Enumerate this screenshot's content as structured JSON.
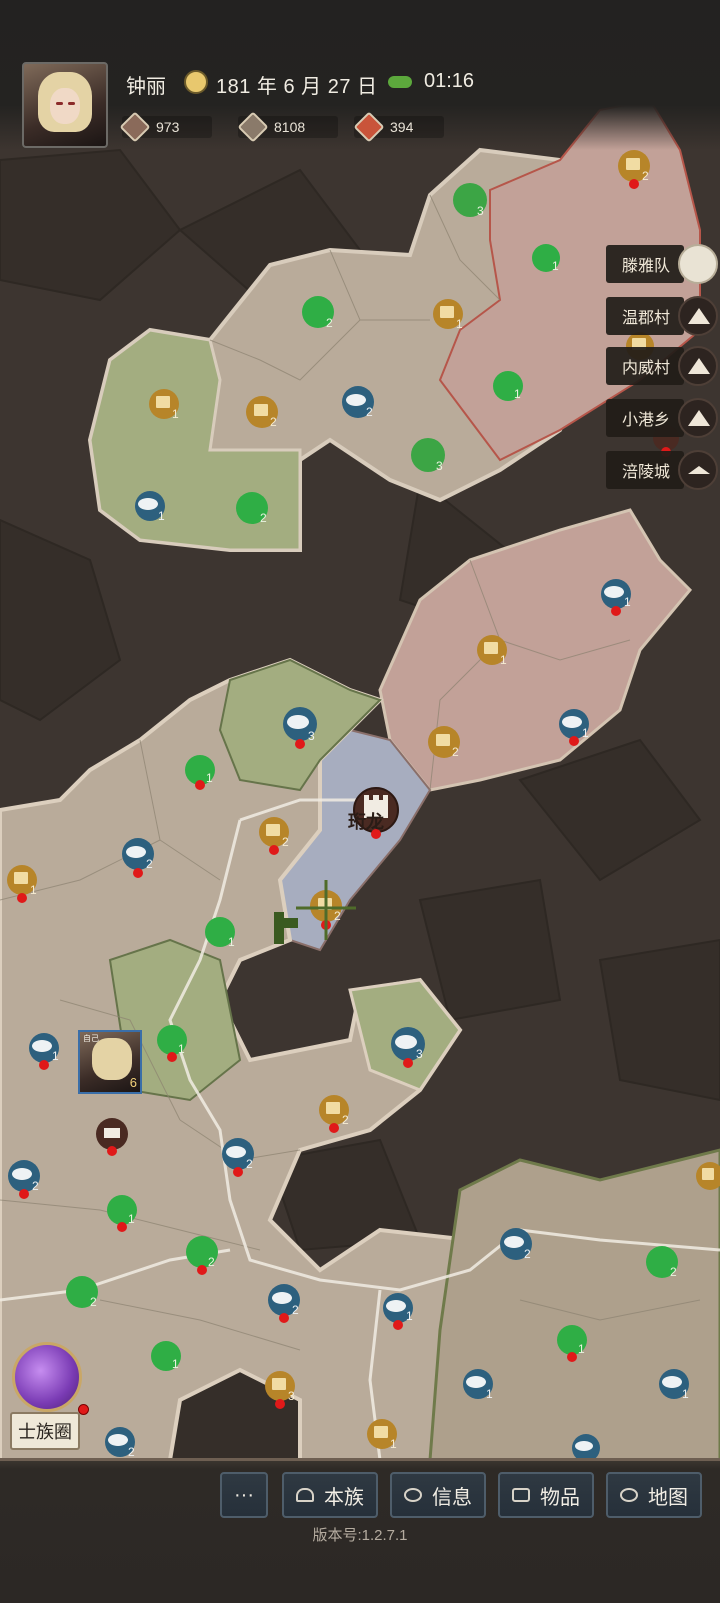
{
  "player": {
    "name": "钟丽",
    "date": "181 年 6 月 27 日",
    "time": "01:16"
  },
  "resources": {
    "res1": "973",
    "res2": "8108",
    "res3": "394"
  },
  "quick_list": {
    "item1": "滕雅队",
    "item2": "温郡村",
    "item3": "内威村",
    "item4": "小港乡",
    "item5": "涪陵城"
  },
  "map": {
    "castle_label": "珩龙",
    "self_tag": "自己",
    "self_level": "6"
  },
  "clan_circle": {
    "label": "士族圈"
  },
  "toolbar": {
    "more": "···",
    "clan": "本族",
    "info": "信息",
    "items": "物品",
    "map": "地图"
  },
  "version": "版本号:1.2.7.1",
  "colors": {
    "dark_region": "#3d3530",
    "beige_region": "#b9ab9a",
    "green_region": "#a3ad80",
    "pink_region": "#c2a198",
    "blue_region": "#a7adbf",
    "accent_gold": "#c9a766"
  }
}
